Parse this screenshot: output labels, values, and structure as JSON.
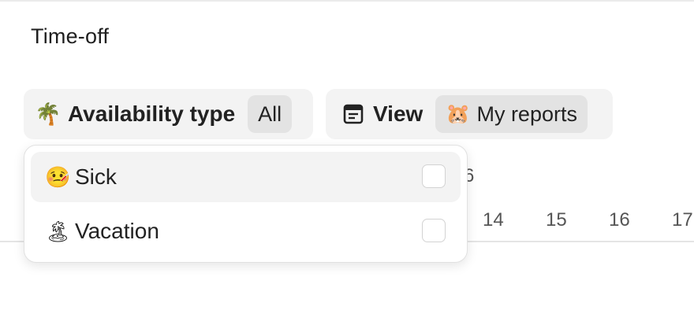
{
  "page": {
    "title": "Time-off"
  },
  "filters": {
    "availability": {
      "icon": "palm-tree-icon",
      "icon_glyph": "🌴",
      "label": "Availability type",
      "value": "All"
    },
    "view": {
      "icon": "calendar-list-icon",
      "icon_glyph": "🗓",
      "label": "View",
      "value_emoji": "🐹",
      "value": "My reports"
    }
  },
  "dropdown": {
    "options": [
      {
        "emoji": "🤒",
        "label": "Sick",
        "checked": false,
        "highlighted": true
      },
      {
        "emoji": "🏝",
        "label": "Vacation",
        "checked": false,
        "highlighted": false
      }
    ]
  },
  "calendar": {
    "partial_label": "6",
    "days": [
      "14",
      "15",
      "16",
      "17"
    ]
  }
}
